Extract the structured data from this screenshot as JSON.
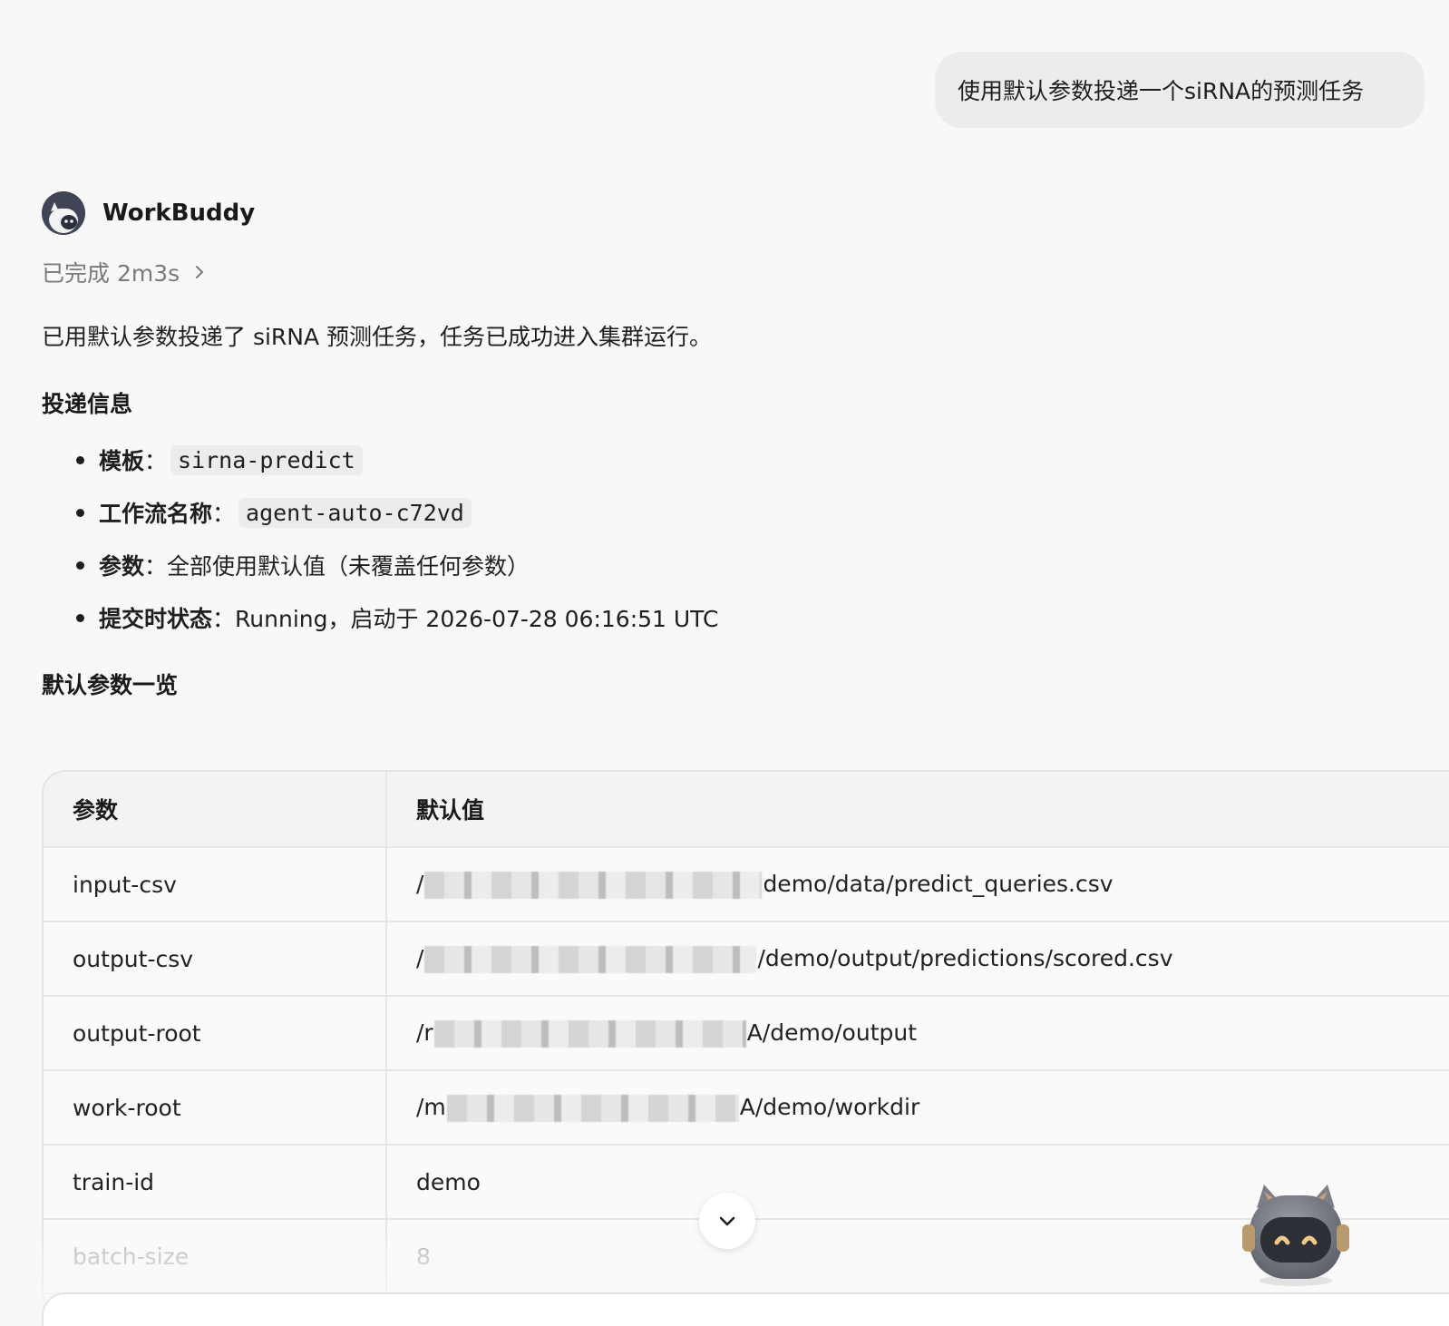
{
  "user_message": "使用默认参数投递一个siRNA的预测任务",
  "agent": {
    "name": "WorkBuddy",
    "status": "已完成 2m3s",
    "summary": "已用默认参数投递了 siRNA 预测任务，任务已成功进入集群运行。"
  },
  "submit_section": {
    "title": "投递信息",
    "items": [
      {
        "key": "模板",
        "sep": "：",
        "code": "sirna-predict"
      },
      {
        "key": "工作流名称",
        "sep": "：",
        "code": "agent-auto-c72vd"
      },
      {
        "key": "参数",
        "sep": "：",
        "text": "全部使用默认值（未覆盖任何参数）"
      },
      {
        "key": "提交时状态",
        "sep": "：",
        "text": "Running，启动于 2026-07-28 06:16:51 UTC"
      }
    ]
  },
  "params_section": {
    "title": "默认参数一览",
    "headers": [
      "参数",
      "默认值"
    ],
    "rows": [
      {
        "name": "input-csv",
        "prefix": "/",
        "suffix": "demo/data/predict_queries.csv",
        "redacted": true
      },
      {
        "name": "output-csv",
        "prefix": "/",
        "suffix": "/demo/output/predictions/scored.csv",
        "redacted": true
      },
      {
        "name": "output-root",
        "prefix": "/r",
        "suffix": "A/demo/output",
        "redacted": true
      },
      {
        "name": "work-root",
        "prefix": "/m",
        "suffix": "A/demo/workdir",
        "redacted": true
      },
      {
        "name": "train-id",
        "value": "demo"
      },
      {
        "name": "batch-size",
        "value": "8"
      }
    ]
  },
  "icons": {
    "status_chevron": "chevron-right-icon",
    "scroll_down": "chevron-down-icon",
    "mascot": "robot-cat-icon",
    "avatar": "workbuddy-avatar-icon"
  },
  "colors": {
    "background": "#f8f8f8",
    "bubble": "#ececec",
    "muted_text": "#7a7a7a",
    "avatar": "#3f4456"
  }
}
